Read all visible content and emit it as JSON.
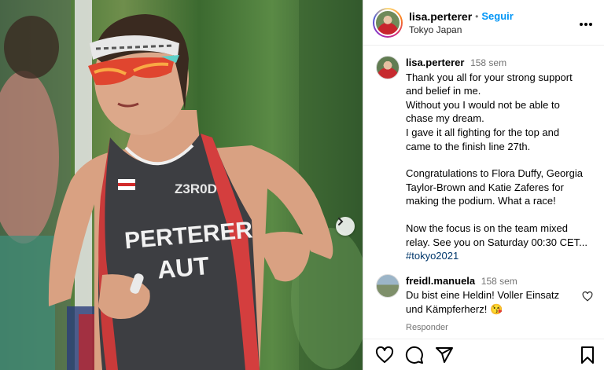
{
  "post": {
    "username": "lisa.perterer",
    "separator": "•",
    "follow_label": "Seguir",
    "location": "Tokyo Japan",
    "more_icon": "more-horizontal-icon"
  },
  "photo": {
    "bib_name": "PERTERER",
    "bib_country": "AUT",
    "sponsor": "Z3R0D",
    "next_icon": "chevron-right-icon"
  },
  "caption": {
    "username": "lisa.perterer",
    "time": "158 sem",
    "lines": [
      "Thank you all for your strong support",
      "and belief in me.",
      "Without you I would not be able to",
      "chase my dream.",
      "I gave it all fighting for the top and",
      "came to the finish line 27th.",
      "",
      "Congratulations to Flora Duffy, Georgia",
      "Taylor-Brown and Katie Zaferes for",
      "making the podium. What a race!",
      "",
      "Now the focus is on the team mixed",
      "relay. See you on Saturday 00:30 CET..."
    ],
    "hashtag": "#tokyo2021"
  },
  "comments": [
    {
      "username": "freidl.manuela",
      "time": "158 sem",
      "lines": [
        "Du bist eine Heldin! Voller Einsatz",
        "und Kämpferherz! 😘"
      ],
      "reply_label": "Responder"
    }
  ],
  "actions": [
    "heart-icon",
    "comment-icon",
    "share-icon",
    "bookmark-icon"
  ],
  "colors": {
    "link_blue": "#0095f6",
    "hashtag": "#00376b",
    "muted": "#737373"
  }
}
